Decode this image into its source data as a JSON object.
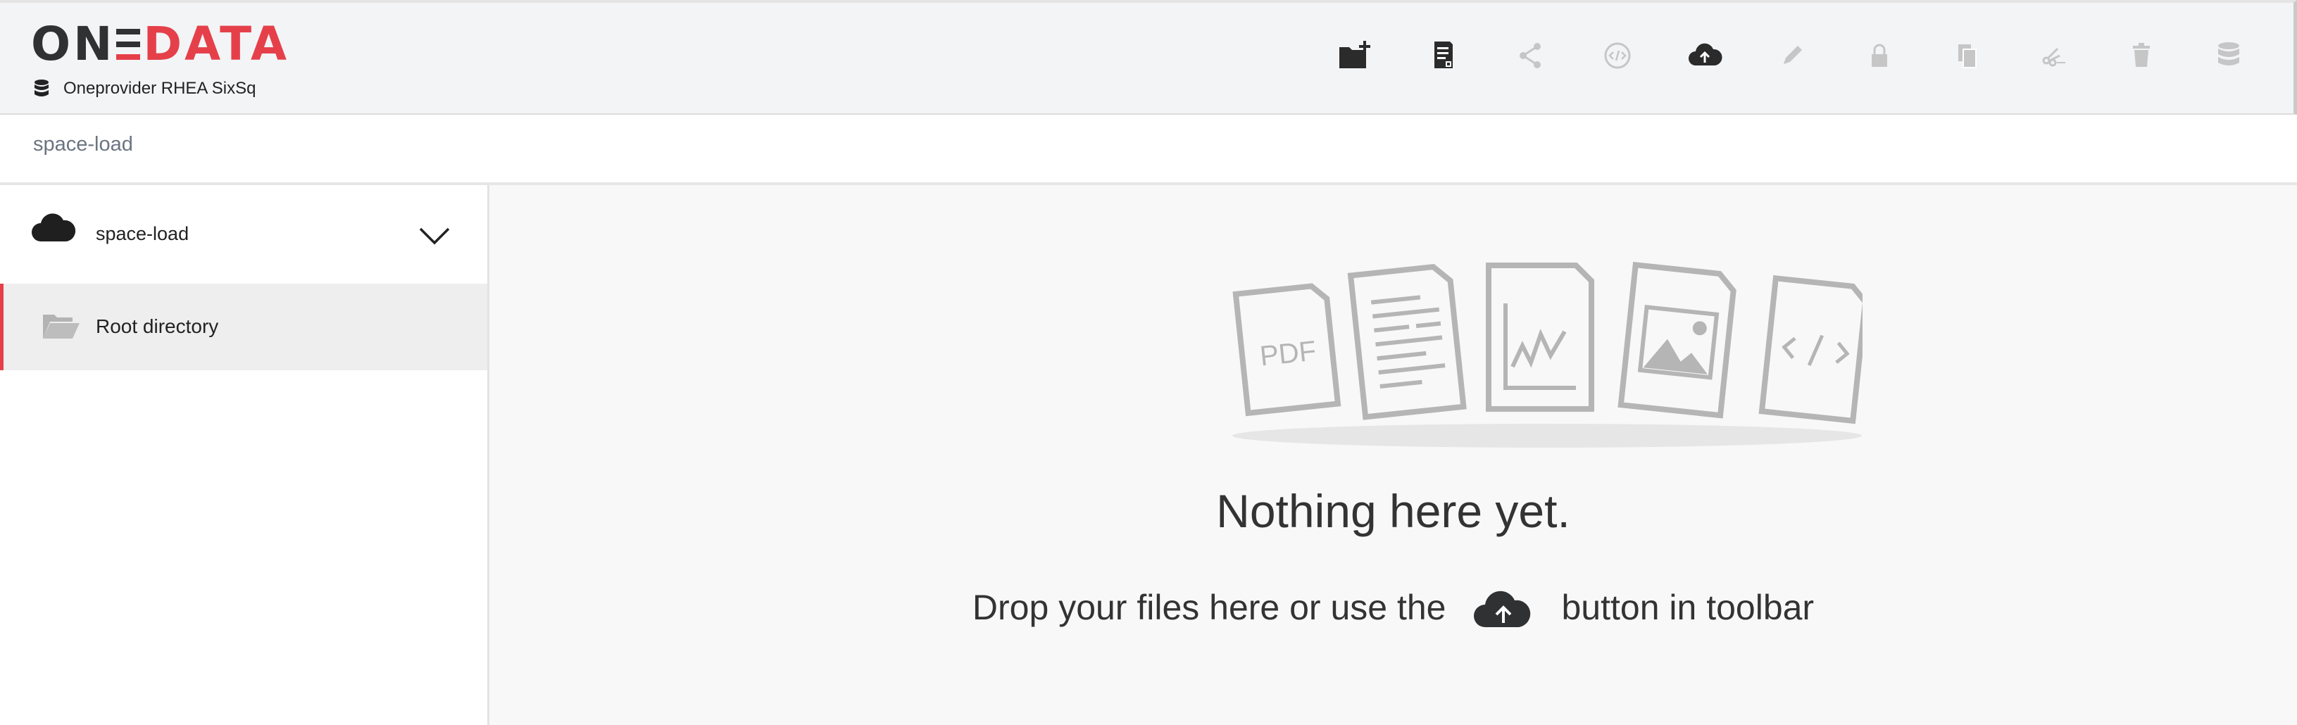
{
  "header": {
    "logo": {
      "part1": "ON",
      "part2": "DATA"
    },
    "provider_name": "Oneprovider RHEA SixSq",
    "toolbar": [
      {
        "name": "new-directory-icon",
        "enabled": true
      },
      {
        "name": "new-file-icon",
        "enabled": true
      },
      {
        "name": "share-icon",
        "enabled": false
      },
      {
        "name": "metadata-icon",
        "enabled": false
      },
      {
        "name": "upload-icon",
        "enabled": true
      },
      {
        "name": "rename-icon",
        "enabled": false
      },
      {
        "name": "permissions-icon",
        "enabled": false
      },
      {
        "name": "copy-icon",
        "enabled": false
      },
      {
        "name": "cut-icon",
        "enabled": false
      },
      {
        "name": "delete-icon",
        "enabled": false
      },
      {
        "name": "distribution-icon",
        "enabled": false
      }
    ]
  },
  "breadcrumb": {
    "current": "space-load"
  },
  "sidebar": {
    "space": {
      "label": "space-load",
      "icon": "cloud-icon"
    },
    "items": [
      {
        "label": "Root directory",
        "icon": "folder-open-icon",
        "active": true
      }
    ]
  },
  "main": {
    "empty_title": "Nothing here yet.",
    "empty_sub_before": "Drop your files here or use the",
    "empty_sub_after": "button in toolbar",
    "illustration_pdf_label": "PDF"
  },
  "colors": {
    "brand_red": "#e5404a",
    "logo_dark": "#2f3133",
    "icon_enabled": "#2b2b2b",
    "icon_disabled": "#c6c6c6"
  }
}
